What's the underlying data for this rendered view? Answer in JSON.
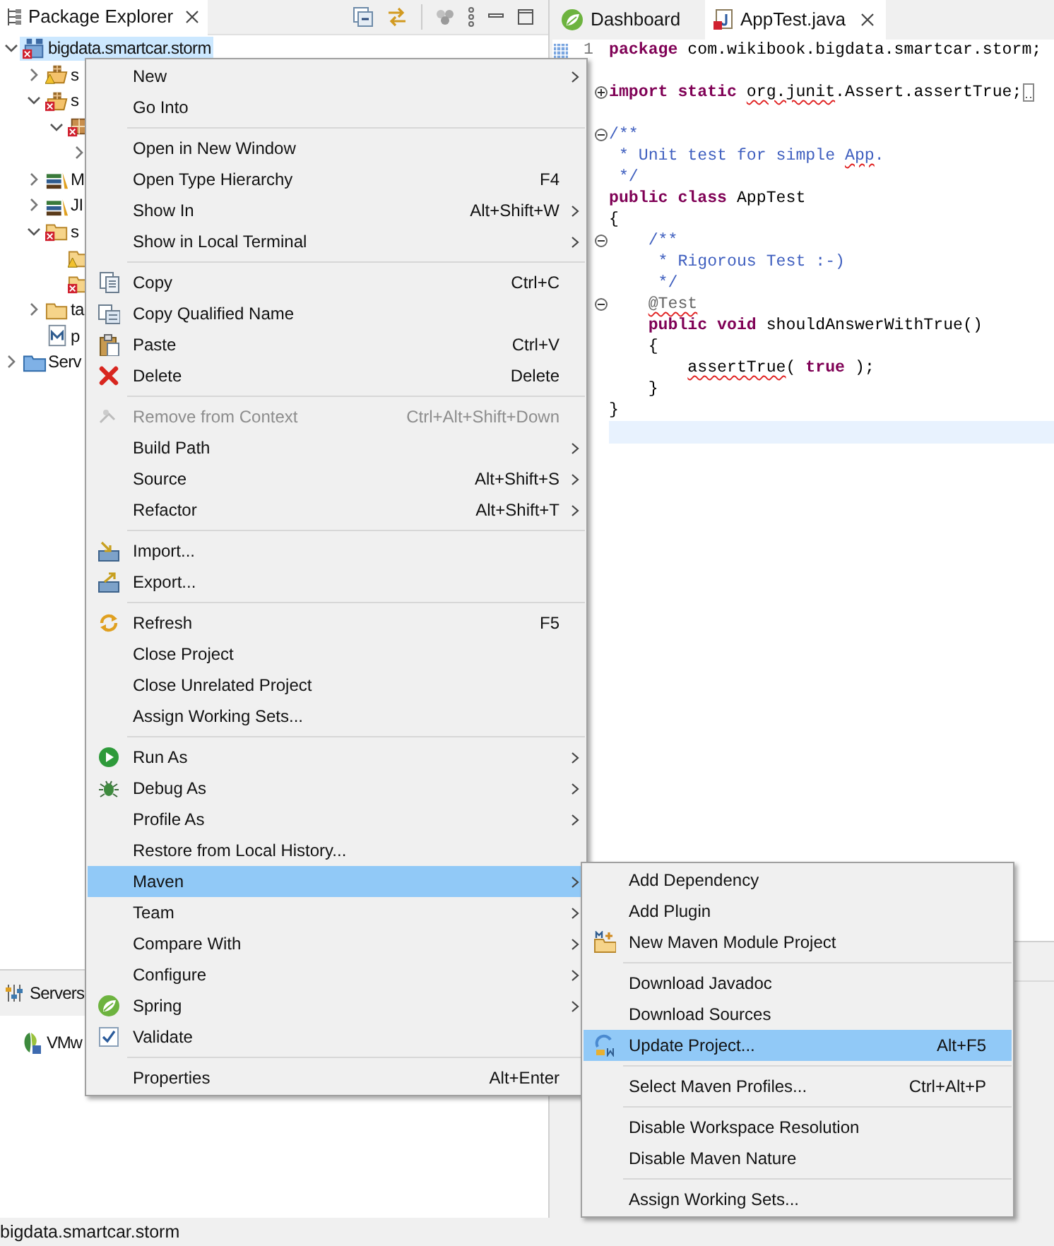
{
  "explorer": {
    "title": "Package Explorer",
    "tree": [
      {
        "label": "bigdata.smartcar.storm",
        "kind": "project",
        "error": true,
        "warning": false,
        "expanded": true,
        "selected": true,
        "children": [
          {
            "label": "s",
            "kind": "sourcefolder",
            "error": false,
            "warning": true,
            "expanded": false,
            "selected": false
          },
          {
            "label": "s",
            "kind": "sourcefolder",
            "error": true,
            "warning": false,
            "expanded": true,
            "selected": false,
            "children": [
              {
                "kind": "package",
                "error": true,
                "warning": false,
                "expanded": true,
                "selected": false,
                "children": [
                  {
                    "expanded": false,
                    "selected": false
                  }
                ]
              }
            ]
          },
          {
            "label": "M",
            "kind": "library",
            "error": false,
            "warning": false,
            "expanded": false,
            "selected": false
          },
          {
            "label": "JI",
            "kind": "library",
            "error": false,
            "warning": false,
            "expanded": false,
            "selected": false
          },
          {
            "label": "s",
            "kind": "folder",
            "error": true,
            "warning": false,
            "expanded": true,
            "selected": false,
            "children": [
              {
                "kind": "folder",
                "error": false,
                "warning": true,
                "selected": false
              },
              {
                "kind": "folder",
                "error": true,
                "warning": false,
                "selected": false
              }
            ]
          },
          {
            "label": "ta",
            "kind": "folder",
            "error": false,
            "warning": false,
            "expanded": false,
            "selected": false
          },
          {
            "label": "p",
            "kind": "pom",
            "error": false,
            "warning": false,
            "selected": false
          }
        ]
      },
      {
        "label": "Serv",
        "kind": "serversfolder",
        "error": false,
        "warning": false,
        "expanded": false,
        "selected": false
      }
    ]
  },
  "servers": {
    "title": "Servers",
    "items": [
      {
        "label": "VMw"
      }
    ]
  },
  "editor": {
    "tabs": [
      {
        "label": "Dashboard",
        "kind": "spring",
        "selected": false
      },
      {
        "label": "AppTest.java",
        "kind": "java",
        "selected": true
      }
    ],
    "lines": [
      {
        "number": "1",
        "current": false,
        "tokens": [
          {
            "kind": "keyword",
            "text": "package",
            "error": false
          },
          {
            "kind": "plain",
            "text": " com.wikibook.bigdata.smartcar.storm;",
            "error": false
          }
        ]
      },
      {
        "current": false
      },
      {
        "current": false,
        "collapsible": true,
        "folded": true,
        "tokens": [
          {
            "kind": "keyword",
            "text": "import static ",
            "error": false
          },
          {
            "kind": "plain",
            "text": "org.junit",
            "error": true
          },
          {
            "kind": "plain",
            "text": ".Assert.assertTrue;",
            "error": false
          }
        ]
      },
      {
        "current": false
      },
      {
        "current": false,
        "collapsible": true,
        "folded": false,
        "tokens": [
          {
            "kind": "comment",
            "text": "/**",
            "error": false
          }
        ]
      },
      {
        "current": false,
        "tokens": [
          {
            "kind": "comment",
            "text": " * Unit test for simple ",
            "error": false
          },
          {
            "kind": "comment",
            "text": "App",
            "error": true
          },
          {
            "kind": "comment",
            "text": ".",
            "error": false
          }
        ]
      },
      {
        "current": false,
        "tokens": [
          {
            "kind": "comment",
            "text": " */",
            "error": false
          }
        ]
      },
      {
        "current": false,
        "tokens": [
          {
            "kind": "keyword",
            "text": "public class",
            "error": false
          },
          {
            "kind": "plain",
            "text": " AppTest",
            "error": false
          }
        ]
      },
      {
        "current": false,
        "tokens": [
          {
            "kind": "plain",
            "text": "{",
            "error": false
          }
        ]
      },
      {
        "current": false,
        "collapsible": true,
        "folded": false,
        "tokens": [
          {
            "kind": "comment",
            "text": "    /**",
            "error": false
          }
        ]
      },
      {
        "current": false,
        "tokens": [
          {
            "kind": "comment",
            "text": "     * Rigorous Test :-)",
            "error": false
          }
        ]
      },
      {
        "current": false,
        "tokens": [
          {
            "kind": "comment",
            "text": "     */",
            "error": false
          }
        ]
      },
      {
        "current": false,
        "collapsible": true,
        "folded": false,
        "tokens": [
          {
            "kind": "annotation",
            "text": "    @Test",
            "error": true
          }
        ]
      },
      {
        "current": false,
        "tokens": [
          {
            "kind": "keyword",
            "text": "    public void",
            "error": false
          },
          {
            "kind": "plain",
            "text": " shouldAnswerWithTrue()",
            "error": false
          }
        ]
      },
      {
        "current": false,
        "tokens": [
          {
            "kind": "plain",
            "text": "    {",
            "error": false
          }
        ]
      },
      {
        "current": false,
        "tokens": [
          {
            "kind": "plain",
            "text": "        assertTrue",
            "error": true
          },
          {
            "kind": "plain",
            "text": "( ",
            "error": false
          },
          {
            "kind": "keyword",
            "text": "true",
            "error": false
          },
          {
            "kind": "plain",
            "text": " );",
            "error": false
          }
        ]
      },
      {
        "current": false,
        "tokens": [
          {
            "kind": "plain",
            "text": "    }",
            "error": false
          }
        ]
      },
      {
        "current": false,
        "tokens": [
          {
            "kind": "plain",
            "text": "}",
            "error": false
          }
        ]
      },
      {
        "current": true
      }
    ]
  },
  "context_menu": {
    "items": [
      {
        "kind": "item",
        "label": "New",
        "submenu": true,
        "selected": false,
        "disabled": false
      },
      {
        "kind": "item",
        "label": "Go Into",
        "submenu": false,
        "selected": false,
        "disabled": false
      },
      {
        "kind": "separator"
      },
      {
        "kind": "item",
        "label": "Open in New Window",
        "submenu": false,
        "selected": false,
        "disabled": false
      },
      {
        "kind": "item",
        "label": "Open Type Hierarchy",
        "shortcut": "F4",
        "submenu": false,
        "selected": false,
        "disabled": false
      },
      {
        "kind": "item",
        "label": "Show In",
        "shortcut": "Alt+Shift+W",
        "submenu": true,
        "selected": false,
        "disabled": false
      },
      {
        "kind": "item",
        "label": "Show in Local Terminal",
        "submenu": true,
        "selected": false,
        "disabled": false
      },
      {
        "kind": "separator"
      },
      {
        "kind": "copy",
        "label": "Copy",
        "shortcut": "Ctrl+C",
        "submenu": false,
        "selected": false,
        "disabled": false
      },
      {
        "kind": "copyname",
        "label": "Copy Qualified Name",
        "submenu": false,
        "selected": false,
        "disabled": false
      },
      {
        "kind": "paste",
        "label": "Paste",
        "shortcut": "Ctrl+V",
        "submenu": false,
        "selected": false,
        "disabled": false
      },
      {
        "kind": "delete",
        "label": "Delete",
        "shortcut": "Delete",
        "submenu": false,
        "selected": false,
        "disabled": false
      },
      {
        "kind": "separator"
      },
      {
        "kind": "remove",
        "label": "Remove from Context",
        "shortcut": "Ctrl+Alt+Shift+Down",
        "submenu": false,
        "selected": false,
        "disabled": true
      },
      {
        "kind": "item",
        "label": "Build Path",
        "submenu": true,
        "selected": false,
        "disabled": false
      },
      {
        "kind": "item",
        "label": "Source",
        "shortcut": "Alt+Shift+S",
        "submenu": true,
        "selected": false,
        "disabled": false
      },
      {
        "kind": "item",
        "label": "Refactor",
        "shortcut": "Alt+Shift+T",
        "submenu": true,
        "selected": false,
        "disabled": false
      },
      {
        "kind": "separator"
      },
      {
        "kind": "import",
        "label": "Import...",
        "submenu": false,
        "selected": false,
        "disabled": false
      },
      {
        "kind": "export",
        "label": "Export...",
        "submenu": false,
        "selected": false,
        "disabled": false
      },
      {
        "kind": "separator"
      },
      {
        "kind": "refresh",
        "label": "Refresh",
        "shortcut": "F5",
        "submenu": false,
        "selected": false,
        "disabled": false
      },
      {
        "kind": "item",
        "label": "Close Project",
        "submenu": false,
        "selected": false,
        "disabled": false
      },
      {
        "kind": "item",
        "label": "Close Unrelated Project",
        "submenu": false,
        "selected": false,
        "disabled": false
      },
      {
        "kind": "item",
        "label": "Assign Working Sets...",
        "submenu": false,
        "selected": false,
        "disabled": false
      },
      {
        "kind": "separator"
      },
      {
        "kind": "run",
        "label": "Run As",
        "submenu": true,
        "selected": false,
        "disabled": false
      },
      {
        "kind": "debug",
        "label": "Debug As",
        "submenu": true,
        "selected": false,
        "disabled": false
      },
      {
        "kind": "item",
        "label": "Profile As",
        "submenu": true,
        "selected": false,
        "disabled": false
      },
      {
        "kind": "item",
        "label": "Restore from Local History...",
        "submenu": false,
        "selected": false,
        "disabled": false
      },
      {
        "kind": "item",
        "label": "Maven",
        "submenu": true,
        "selected": true,
        "disabled": false
      },
      {
        "kind": "item",
        "label": "Team",
        "submenu": true,
        "selected": false,
        "disabled": false
      },
      {
        "kind": "item",
        "label": "Compare With",
        "submenu": true,
        "selected": false,
        "disabled": false
      },
      {
        "kind": "item",
        "label": "Configure",
        "submenu": true,
        "selected": false,
        "disabled": false
      },
      {
        "kind": "spring",
        "label": "Spring",
        "submenu": true,
        "selected": false,
        "disabled": false
      },
      {
        "kind": "validate",
        "label": "Validate",
        "submenu": false,
        "selected": false,
        "disabled": false
      },
      {
        "kind": "separator"
      },
      {
        "kind": "item",
        "label": "Properties",
        "shortcut": "Alt+Enter",
        "submenu": false,
        "selected": false,
        "disabled": false
      }
    ]
  },
  "maven_submenu": {
    "items": [
      {
        "kind": "item",
        "label": "Add Dependency",
        "submenu": false,
        "selected": false,
        "disabled": false
      },
      {
        "kind": "item",
        "label": "Add Plugin",
        "submenu": false,
        "selected": false,
        "disabled": false
      },
      {
        "kind": "module",
        "label": "New Maven Module Project",
        "submenu": false,
        "selected": false,
        "disabled": false
      },
      {
        "kind": "separator"
      },
      {
        "kind": "item",
        "label": "Download Javadoc",
        "submenu": false,
        "selected": false,
        "disabled": false
      },
      {
        "kind": "item",
        "label": "Download Sources",
        "submenu": false,
        "selected": false,
        "disabled": false
      },
      {
        "kind": "update",
        "label": "Update Project...",
        "shortcut": "Alt+F5",
        "submenu": false,
        "selected": true,
        "disabled": false
      },
      {
        "kind": "separator"
      },
      {
        "kind": "item",
        "label": "Select Maven Profiles...",
        "shortcut": "Ctrl+Alt+P",
        "submenu": false,
        "selected": false,
        "disabled": false
      },
      {
        "kind": "separator"
      },
      {
        "kind": "item",
        "label": "Disable Workspace Resolution",
        "submenu": false,
        "selected": false,
        "disabled": false
      },
      {
        "kind": "item",
        "label": "Disable Maven Nature",
        "submenu": false,
        "selected": false,
        "disabled": false
      },
      {
        "kind": "separator"
      },
      {
        "kind": "item",
        "label": "Assign Working Sets...",
        "submenu": false,
        "selected": false,
        "disabled": false
      }
    ]
  },
  "status_bar": {
    "text": "bigdata.smartcar.storm"
  }
}
